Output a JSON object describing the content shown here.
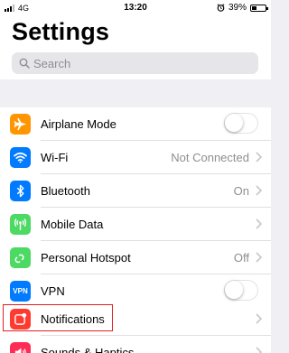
{
  "status_bar": {
    "carrier": "4G",
    "time": "13:20",
    "battery_percent": "39%",
    "battery_level": 0.39
  },
  "header": {
    "title": "Settings",
    "search_placeholder": "Search"
  },
  "rows": {
    "airplane": {
      "label": "Airplane Mode",
      "icon": "airplane-icon",
      "color": "#ff9500",
      "toggle": false
    },
    "wifi": {
      "label": "Wi-Fi",
      "value": "Not Connected",
      "icon": "wifi-icon",
      "color": "#007aff"
    },
    "bluetooth": {
      "label": "Bluetooth",
      "value": "On",
      "icon": "bluetooth-icon",
      "color": "#007aff"
    },
    "mobile_data": {
      "label": "Mobile Data",
      "icon": "antenna-icon",
      "color": "#4cd964"
    },
    "hotspot": {
      "label": "Personal Hotspot",
      "value": "Off",
      "icon": "hotspot-icon",
      "color": "#4cd964"
    },
    "vpn": {
      "label": "VPN",
      "icon_text": "VPN",
      "icon": "vpn-icon",
      "color": "#007aff",
      "toggle": false
    },
    "notifications": {
      "label": "Notifications",
      "icon": "notifications-icon",
      "color": "#ff3b30",
      "highlighted": true
    },
    "sounds": {
      "label": "Sounds & Haptics",
      "icon": "speaker-icon",
      "color": "#ff2d55"
    }
  },
  "colors": {
    "background": "#efeff4",
    "secondary_text": "#8e8e93",
    "highlight": "#e02020"
  }
}
